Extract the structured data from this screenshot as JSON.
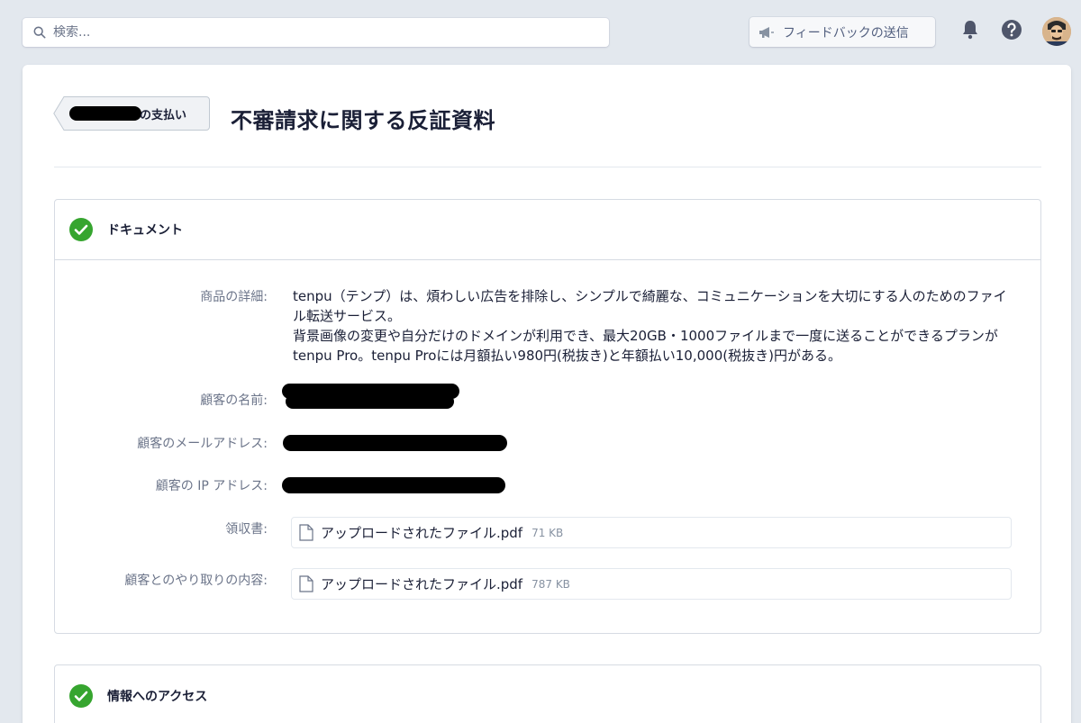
{
  "topbar": {
    "search_placeholder": "検索...",
    "feedback_label": "フィードバックの送信"
  },
  "header": {
    "back_label": "の支払い",
    "title": "不審請求に関する反証資料"
  },
  "document_section": {
    "title": "ドキュメント",
    "product_label": "商品の詳細:",
    "product_desc_1": "tenpu（テンプ）は、煩わしい広告を排除し、シンプルで綺麗な、コミュニケーションを大切にする人のためのファイル転送サービス。",
    "product_desc_2": "背景画像の変更や自分だけのドメインが利用でき、最大20GB・1000ファイルまで一度に送ることができるプランがtenpu Pro。tenpu Proには月額払い980円(税抜き)と年額払い10,000(税抜き)円がある。",
    "customer_name_label": "顧客の名前:",
    "customer_email_label": "顧客のメールアドレス:",
    "customer_ip_label": "顧客の IP アドレス:",
    "receipt_label": "領収書:",
    "receipt_file": {
      "name": "アップロードされたファイル.pdf",
      "size": "71 KB"
    },
    "communication_label": "顧客とのやり取りの内容:",
    "communication_file": {
      "name": "アップロードされたファイル.pdf",
      "size": "787 KB"
    }
  },
  "access_section": {
    "title": "情報へのアクセス"
  },
  "colors": {
    "background": "#e3e8ee",
    "check_green": "#36a52f",
    "text": "#1a1f36",
    "muted": "#6b7489"
  },
  "icons": [
    "search-icon",
    "megaphone-icon",
    "bell-icon",
    "help-icon",
    "check-circle-icon",
    "file-icon"
  ]
}
